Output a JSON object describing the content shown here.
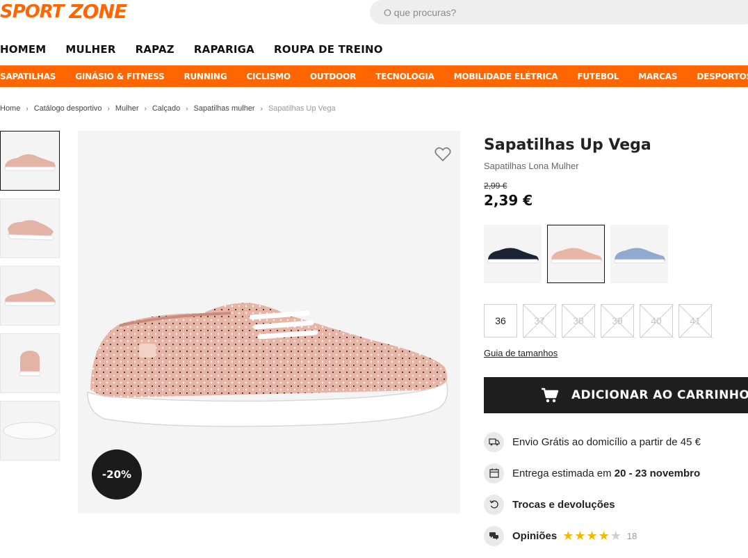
{
  "header": {
    "logo_part1": "SPORT",
    "logo_part2": "ZONE",
    "search_placeholder": "O que procuras?"
  },
  "main_nav": [
    "HOMEM",
    "MULHER",
    "RAPAZ",
    "RAPARIGA",
    "ROUPA DE TREINO"
  ],
  "category_bar": [
    "SAPATILHAS",
    "GINÁSIO & FITNESS",
    "RUNNING",
    "CICLISMO",
    "OUTDOOR",
    "TECNOLOGIA",
    "MOBILIDADE ELÉTRICA",
    "FUTEBOL",
    "MARCAS",
    "DESPORTOS"
  ],
  "breadcrumb": [
    "Home",
    "Catálogo desportivo",
    "Mulher",
    "Calçado",
    "Sapatilhas mulher",
    "Sapatilhas Up Vega"
  ],
  "gallery": {
    "discount_badge": "-20%",
    "thumbnail_count": 5
  },
  "product": {
    "title": "Sapatilhas Up Vega",
    "subtitle": "Sapatilhas Lona Mulher",
    "old_price": "2,99 €",
    "price": "2,39 €"
  },
  "colors": [
    {
      "name": "navy",
      "hex": "#1c2433"
    },
    {
      "name": "pink",
      "hex": "#e7b6a6"
    },
    {
      "name": "light-blue",
      "hex": "#8fa9cf"
    }
  ],
  "sizes": [
    {
      "label": "36",
      "available": true
    },
    {
      "label": "37",
      "available": false
    },
    {
      "label": "38",
      "available": false
    },
    {
      "label": "39",
      "available": false
    },
    {
      "label": "40",
      "available": false
    },
    {
      "label": "41",
      "available": false
    }
  ],
  "size_guide_label": "Guia de tamanhos",
  "cart_button_label": "ADICIONAR AO CARRINHO",
  "perks": {
    "shipping": "Envio Grátis ao domicílio a partir de 45 €",
    "delivery_prefix": "Entrega estimada em ",
    "delivery_dates": "20 - 23 novembro",
    "returns": "Trocas e devoluções",
    "reviews_label": "Opiniões",
    "reviews_count": "18",
    "rating": 4
  },
  "colors_theme": {
    "brand": "#ff6600",
    "dark": "#1f1f1f",
    "star": "#f5b800"
  }
}
